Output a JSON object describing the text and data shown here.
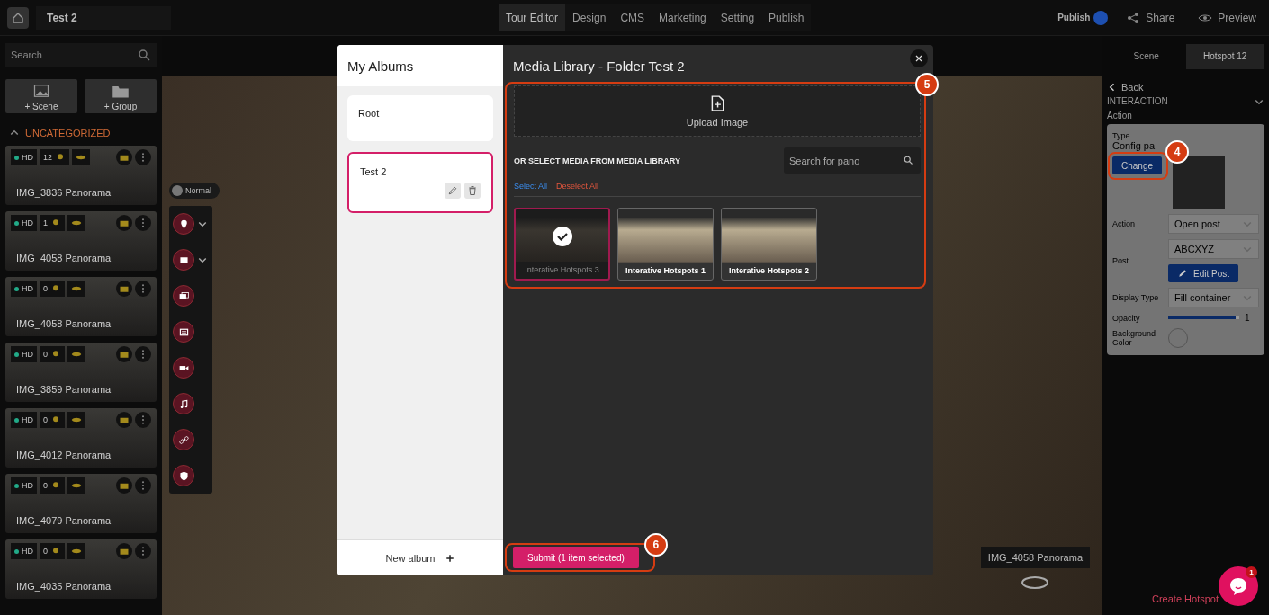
{
  "app_bar": {
    "project": "Test 2",
    "nav": [
      {
        "label": "Tour Editor",
        "selected": true
      },
      {
        "label": "Design",
        "selected": false
      },
      {
        "label": "CMS",
        "selected": false
      },
      {
        "label": "Marketing",
        "selected": false
      },
      {
        "label": "Setting",
        "selected": false
      },
      {
        "label": "Publish",
        "selected": false
      }
    ],
    "publish": {
      "label": "Publish",
      "on": true
    },
    "share": "Share",
    "preview": "Preview"
  },
  "sidebar": {
    "search_placeholder": "Search",
    "add_buttons": [
      {
        "label": "+ Scene",
        "kind": "image"
      },
      {
        "label": "+ Group",
        "kind": "folder"
      }
    ],
    "group": "UNCATEGORIZED",
    "scenes": [
      {
        "name": "IMG_3836 Panorama",
        "quality": "HD",
        "hotspots": "12"
      },
      {
        "name": "IMG_4058 Panorama",
        "quality": "HD",
        "hotspots": "1"
      },
      {
        "name": "IMG_4058 Panorama",
        "quality": "HD",
        "hotspots": "0"
      },
      {
        "name": "IMG_3859 Panorama",
        "quality": "HD",
        "hotspots": "0"
      },
      {
        "name": "IMG_4012 Panorama",
        "quality": "HD",
        "hotspots": "0"
      },
      {
        "name": "IMG_4079 Panorama",
        "quality": "HD",
        "hotspots": "0"
      },
      {
        "name": "IMG_4035 Panorama",
        "quality": "HD",
        "hotspots": "0"
      }
    ]
  },
  "canvas": {
    "mode_toggle": "Normal",
    "tools": [
      {
        "kind": "pin",
        "has_menu": true
      },
      {
        "kind": "image",
        "has_menu": true
      },
      {
        "kind": "gallery",
        "has_menu": false
      },
      {
        "kind": "text",
        "has_menu": false
      },
      {
        "kind": "video",
        "has_menu": false
      },
      {
        "kind": "audio",
        "has_menu": false
      },
      {
        "kind": "link",
        "has_menu": false
      },
      {
        "kind": "shield",
        "has_menu": false
      }
    ],
    "scene_label": "IMG_4058 Panorama"
  },
  "inspector": {
    "tabs": [
      {
        "label": "Scene",
        "selected": false
      },
      {
        "label": "Hotspot 12",
        "selected": true
      }
    ],
    "back": "Back",
    "section": "INTERACTION",
    "subsection": "Action",
    "card": {
      "type_label": "Type",
      "config": "Config pa",
      "change": "Change",
      "change_callout": "4",
      "rows": [
        {
          "kind": "select",
          "label": "Action",
          "value": "Open post"
        },
        {
          "kind": "select",
          "label": "Post",
          "value": "ABCXYZ",
          "button": "Edit Post"
        },
        {
          "kind": "select",
          "label": "Display Type",
          "value": "Fill container"
        },
        {
          "kind": "slider",
          "label": "Opacity",
          "level": 0.95,
          "reading": "1"
        },
        {
          "kind": "color",
          "label": "Background Color"
        }
      ]
    },
    "create": "Create Hotspot"
  },
  "modal": {
    "albums_title": "My Albums",
    "albums": [
      {
        "name": "Root",
        "selected": false
      },
      {
        "name": "Test 2",
        "selected": true
      }
    ],
    "new_album": "New album",
    "title": "Media Library - Folder Test 2",
    "upload": "Upload Image",
    "select_heading": "OR SELECT MEDIA FROM MEDIA LIBRARY",
    "search_placeholder": "Search for pano",
    "select_all": "Select All",
    "deselect_all": "Deselect All",
    "media": [
      {
        "name": "Interative Hotspots 3",
        "selected": true
      },
      {
        "name": "Interative Hotspots 1",
        "selected": false
      },
      {
        "name": "Interative Hotspots 2",
        "selected": false
      }
    ],
    "media_callout": "5",
    "submit": "Submit (1 item selected)",
    "submit_callout": "6"
  },
  "chat": {
    "badge": "1"
  }
}
